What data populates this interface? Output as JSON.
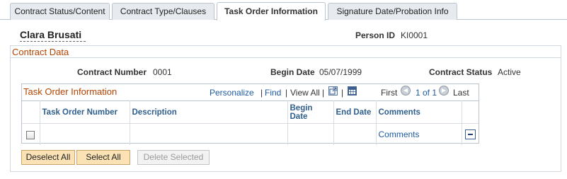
{
  "tabs": [
    {
      "label": "Contract Status/Content",
      "active": false
    },
    {
      "label": "Contract Type/Clauses",
      "active": false
    },
    {
      "label": "Task Order Information",
      "active": true
    },
    {
      "label": "Signature Date/Probation Info",
      "active": false
    }
  ],
  "header": {
    "name": "Clara Brusati",
    "person_id_label": "Person ID",
    "person_id_value": "KI0001"
  },
  "contract_data": {
    "title": "Contract Data",
    "contract_number_label": "Contract Number",
    "contract_number_value": "0001",
    "begin_date_label": "Begin Date",
    "begin_date_value": "05/07/1999",
    "contract_status_label": "Contract Status",
    "contract_status_value": "Active"
  },
  "grid": {
    "title": "Task Order Information",
    "personalize": "Personalize",
    "find": "Find",
    "view_all": "View All",
    "first": "First",
    "range": "1 of 1",
    "last": "Last",
    "columns": [
      "",
      "Task Order Number",
      "Description",
      "Begin Date",
      "End Date",
      "Comments",
      ""
    ],
    "rows": [
      {
        "checked": false,
        "task_order_number": "",
        "description": "",
        "begin_date": "",
        "end_date": "",
        "comments_link": "Comments"
      }
    ]
  },
  "buttons": {
    "deselect_all": "Deselect All",
    "select_all": "Select All",
    "delete_selected": "Delete Selected"
  },
  "colors": {
    "accent_orange": "#b34400",
    "link_blue": "#1e5aa0",
    "header_blue": "#2f5f8d",
    "button_bg": "#fbe2b5"
  }
}
